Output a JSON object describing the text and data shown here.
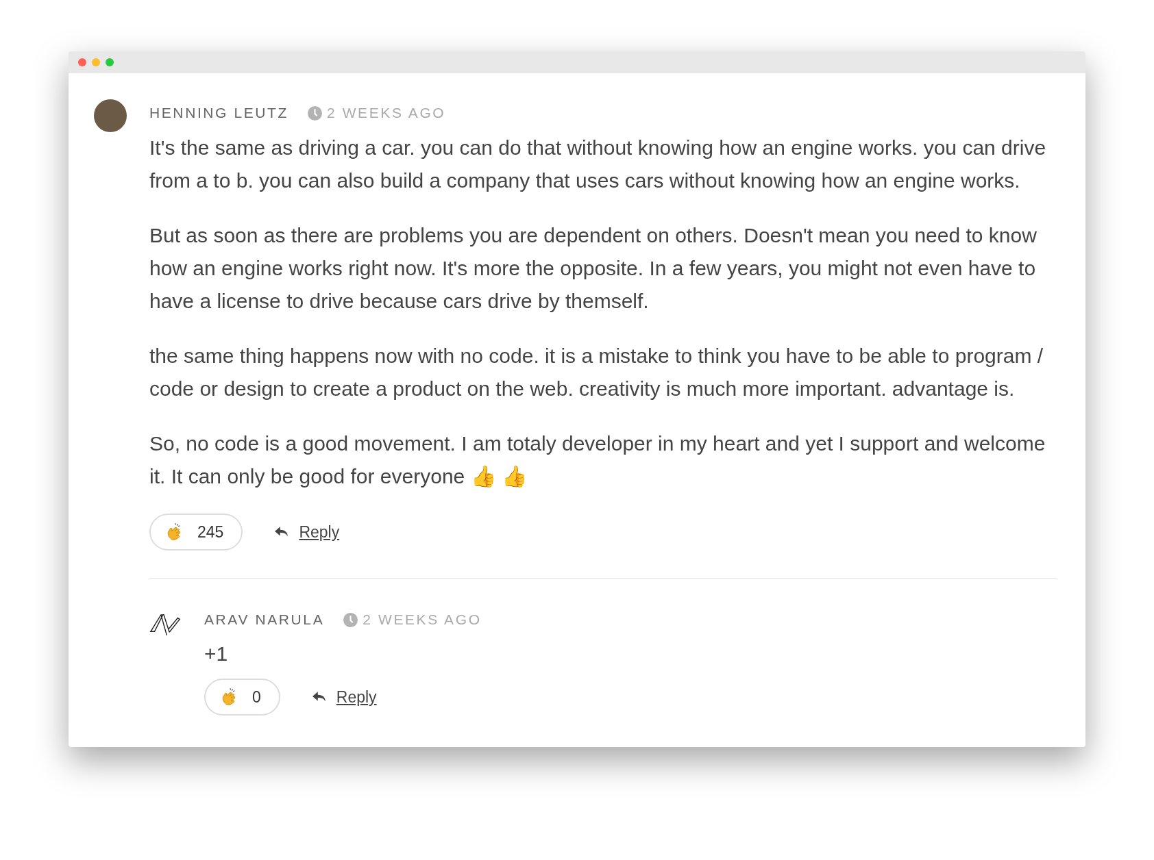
{
  "comment": {
    "author": "HENNING LEUTZ",
    "time": "2 WEEKS AGO",
    "paragraphs": [
      "It's the same as driving a car. you can do that without knowing how an engine works. you can drive from a to b. you can also build a company that uses cars without knowing how an engine works.",
      "But as soon as there are problems you are dependent on others. Doesn't mean you need to know how an engine works right now. It's more the opposite. In a few years, you might not even have to have a license to drive because cars drive by themself.",
      "the same thing happens now with no code. it is a mistake to think you have to be able to program / code or design to create a product on the web. creativity is much more important. advantage is.",
      "So, no code is a good movement. I am totaly developer in my heart and yet I support and welcome it. It can only be good for everyone 👍  👍"
    ],
    "claps": "245",
    "reply": "Reply",
    "replies": [
      {
        "author": "ARAV NARULA",
        "time": "2 WEEKS AGO",
        "paragraphs": [
          "+1"
        ],
        "claps": "0",
        "reply": "Reply"
      }
    ]
  }
}
